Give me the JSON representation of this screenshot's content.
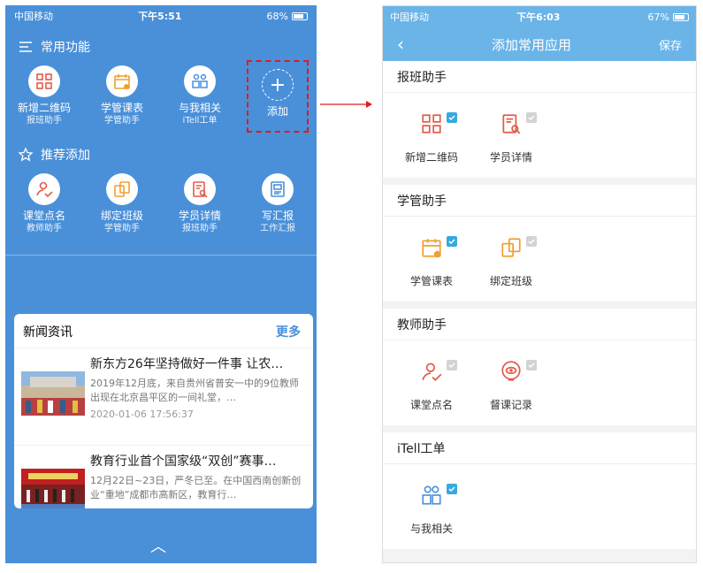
{
  "left_phone": {
    "status": {
      "carrier": "中国移动",
      "time": "下午5:51",
      "battery": "68%"
    },
    "section1_title": "常用功能",
    "common": [
      {
        "l1": "新增二维码",
        "l2": "报班助手",
        "icon": "qrcode-icon"
      },
      {
        "l1": "学管课表",
        "l2": "学管助手",
        "icon": "calendar-icon"
      },
      {
        "l1": "与我相关",
        "l2": "iTell工单",
        "icon": "people-icon"
      }
    ],
    "add_label": "添加",
    "section2_title": "推荐添加",
    "recommended": [
      {
        "l1": "课堂点名",
        "l2": "教师助手",
        "icon": "user-check-icon"
      },
      {
        "l1": "绑定班级",
        "l2": "学管助手",
        "icon": "link-class-icon"
      },
      {
        "l1": "学员详情",
        "l2": "报班助手",
        "icon": "doc-search-icon"
      },
      {
        "l1": "写汇报",
        "l2": "工作汇报",
        "icon": "report-icon"
      }
    ],
    "news": {
      "title": "新闻资讯",
      "more": "更多",
      "items": [
        {
          "title": "新东方26年坚持做好一件事 让农…",
          "desc": "2019年12月底，来自贵州省普安一中的9位教师出现在北京昌平区的一间礼堂，…",
          "time": "2020-01-06 17:56:37"
        },
        {
          "title": "教育行业首个国家级“双创”赛事…",
          "desc": "12月22日~23日，严冬已至。在中国西南创新创业“重地”成都市高新区，教育行…",
          "time": ""
        }
      ]
    }
  },
  "right_phone": {
    "status": {
      "carrier": "中国移动",
      "time": "下午6:03",
      "battery": "67%"
    },
    "nav": {
      "back": "‹",
      "title": "添加常用应用",
      "save": "保存"
    },
    "groups": [
      {
        "name": "报班助手",
        "apps": [
          {
            "label": "新增二维码",
            "checked": true,
            "icon": "qrcode-icon"
          },
          {
            "label": "学员详情",
            "checked": false,
            "icon": "doc-search-icon"
          }
        ]
      },
      {
        "name": "学管助手",
        "apps": [
          {
            "label": "学管课表",
            "checked": true,
            "icon": "calendar-icon"
          },
          {
            "label": "绑定班级",
            "checked": false,
            "icon": "link-class-icon"
          }
        ]
      },
      {
        "name": "教师助手",
        "apps": [
          {
            "label": "课堂点名",
            "checked": false,
            "icon": "user-check-icon"
          },
          {
            "label": "督课记录",
            "checked": false,
            "icon": "eye-icon"
          }
        ]
      },
      {
        "name": "iTell工单",
        "apps": [
          {
            "label": "与我相关",
            "checked": true,
            "icon": "people-icon"
          }
        ]
      }
    ]
  },
  "colors": {
    "primary_blue": "#4a90d9",
    "nav_blue": "#6ab4e8",
    "check_on": "#36a9e1",
    "red": "#e21a1a"
  }
}
